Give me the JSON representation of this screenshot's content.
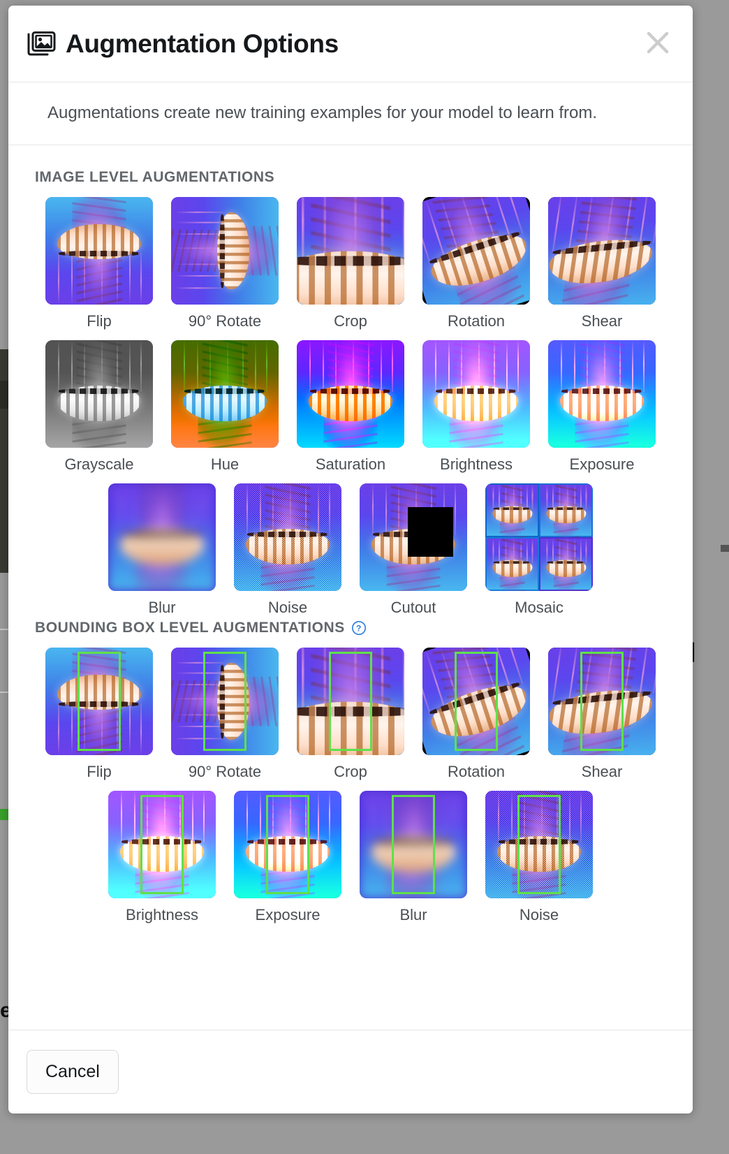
{
  "modal": {
    "title": "Augmentation Options",
    "title_icon": "images-icon",
    "close_icon": "close-icon",
    "subtitle": "Augmentations create new training examples for your model to learn from.",
    "footer": {
      "cancel_label": "Cancel"
    }
  },
  "sections": [
    {
      "id": "image-level",
      "heading": "IMAGE LEVEL AUGMENTATIONS",
      "help_icon": null,
      "rows": [
        [
          {
            "label": "Flip",
            "variant": "v-flip"
          },
          {
            "label": "90° Rotate",
            "variant": "v-rot90"
          },
          {
            "label": "Crop",
            "variant": "v-crop"
          },
          {
            "label": "Rotation",
            "variant": "v-rotation"
          },
          {
            "label": "Shear",
            "variant": "v-shear"
          }
        ],
        [
          {
            "label": "Grayscale",
            "variant": "v-gray"
          },
          {
            "label": "Hue",
            "variant": "v-hue"
          },
          {
            "label": "Saturation",
            "variant": "v-sat"
          },
          {
            "label": "Brightness",
            "variant": "v-bright"
          },
          {
            "label": "Exposure",
            "variant": "v-expo"
          }
        ],
        [
          {
            "label": "Blur",
            "variant": "v-blur"
          },
          {
            "label": "Noise",
            "variant": "v-noise"
          },
          {
            "label": "Cutout",
            "variant": "v-cutout"
          },
          {
            "label": "Mosaic",
            "variant": "v-mosaic"
          }
        ]
      ]
    },
    {
      "id": "bbox-level",
      "heading": "BOUNDING BOX LEVEL AUGMENTATIONS",
      "help_icon": "help-circle-icon",
      "rows": [
        [
          {
            "label": "Flip",
            "variant": "v-flip"
          },
          {
            "label": "90° Rotate",
            "variant": "v-rot90"
          },
          {
            "label": "Crop",
            "variant": "v-crop"
          },
          {
            "label": "Rotation",
            "variant": "v-rotation"
          },
          {
            "label": "Shear",
            "variant": "v-shear"
          }
        ],
        [
          {
            "label": "Brightness",
            "variant": "v-bright"
          },
          {
            "label": "Exposure",
            "variant": "v-expo"
          },
          {
            "label": "Blur",
            "variant": "v-blur"
          },
          {
            "label": "Noise",
            "variant": "v-noise"
          }
        ]
      ]
    }
  ],
  "colors": {
    "help_icon": "#2a7ae2",
    "bbox_stroke": "#5fe04a",
    "title": "#15191c",
    "section_heading": "#62676c",
    "label": "#4a4f54",
    "close": "#cccccc",
    "backdrop": "#9a9a9a"
  }
}
